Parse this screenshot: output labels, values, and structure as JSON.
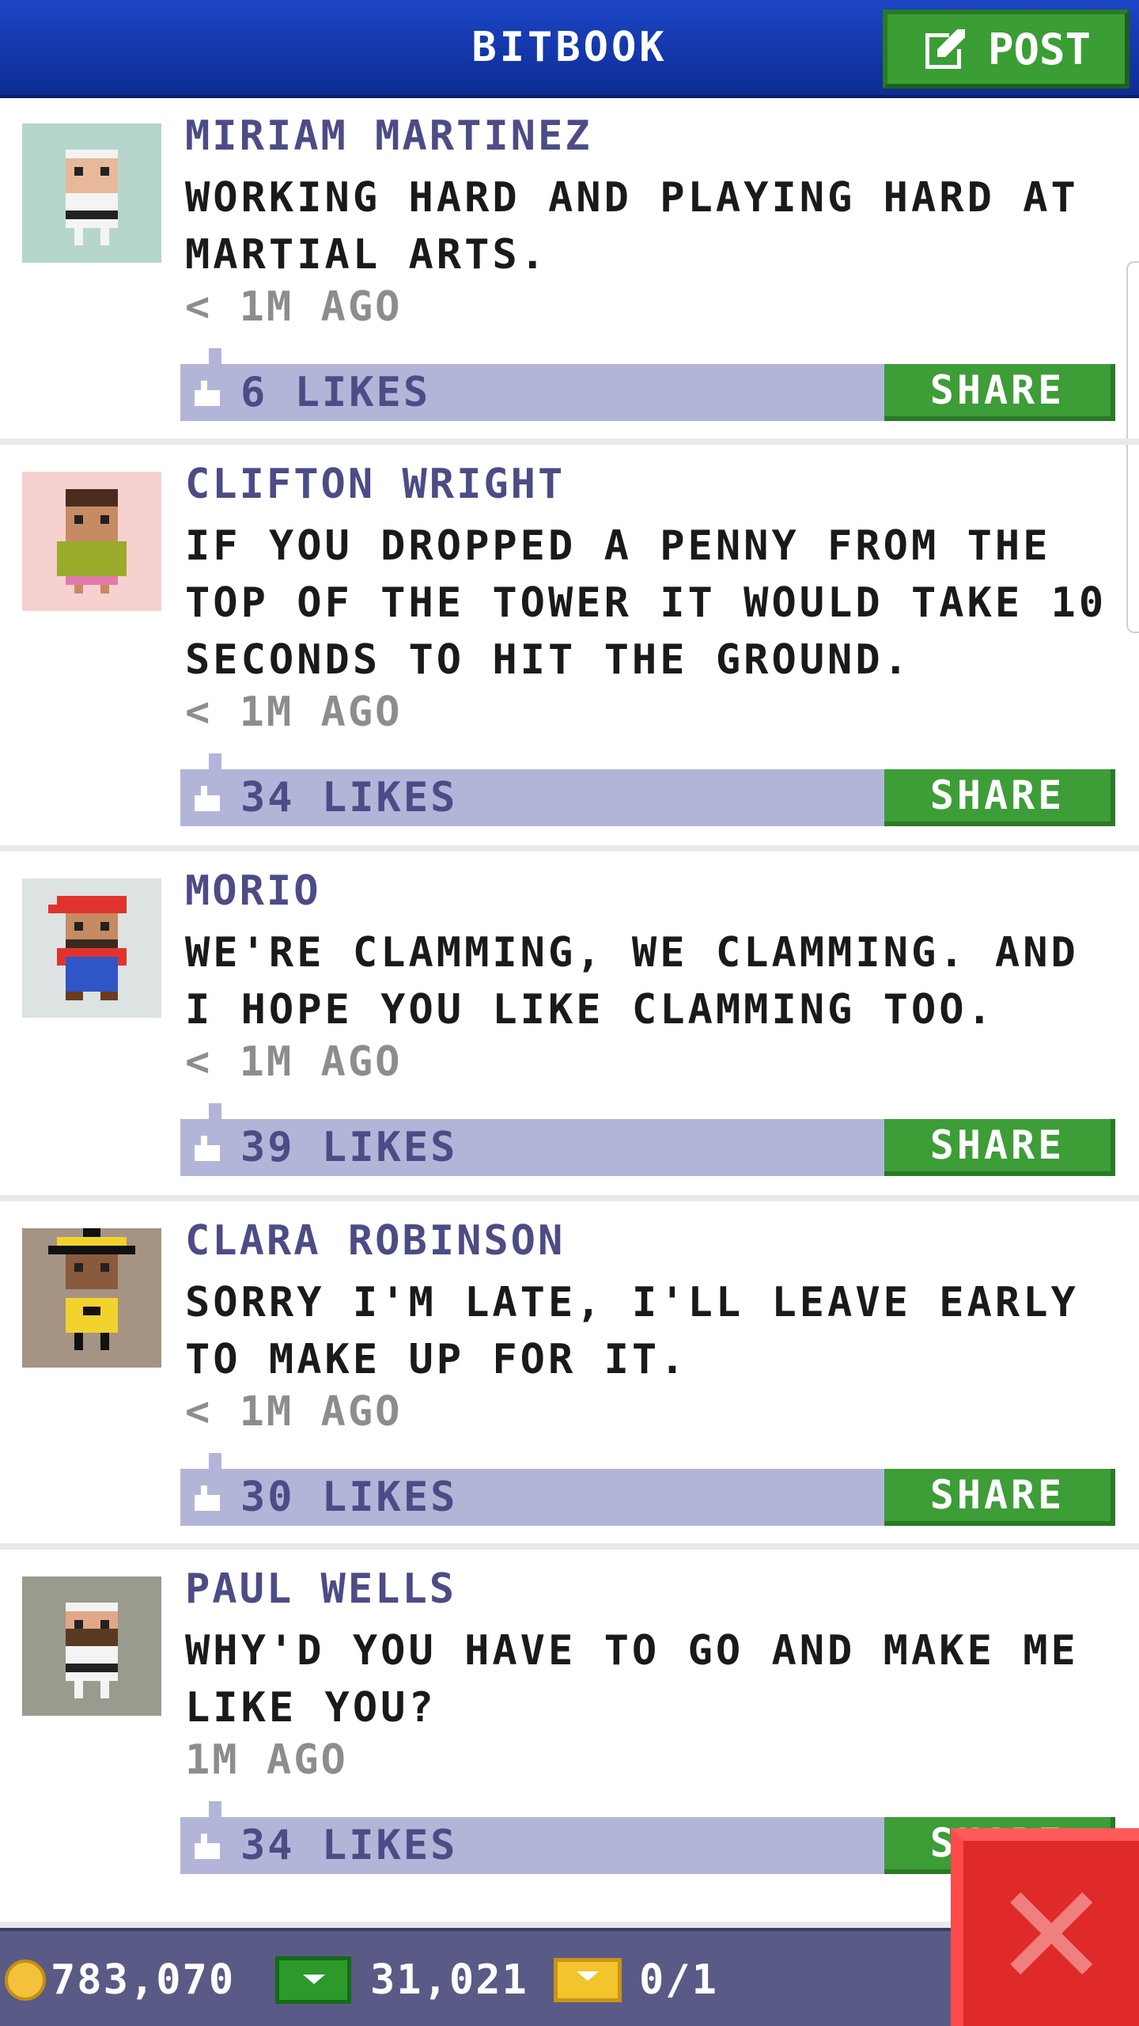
{
  "header": {
    "title": "BITBOOK",
    "post_label": "POST"
  },
  "feed": {
    "posts": [
      {
        "name": "MIRIAM MARTINEZ",
        "message": "WORKING HARD AND PLAYING HARD AT MARTIAL ARTS.",
        "time": "< 1M AGO",
        "likes": "6 LIKES",
        "share": "SHARE"
      },
      {
        "name": "CLIFTON WRIGHT",
        "message": "IF YOU DROPPED A PENNY FROM THE TOP OF THE TOWER IT WOULD TAKE 10 SECONDS TO HIT THE GROUND.",
        "time": "< 1M AGO",
        "likes": "34 LIKES",
        "share": "SHARE"
      },
      {
        "name": "MORIO",
        "message": "WE'RE CLAMMING, WE CLAMMING. AND I HOPE YOU LIKE CLAMMING TOO.",
        "time": "< 1M AGO",
        "likes": "39 LIKES",
        "share": "SHARE"
      },
      {
        "name": "CLARA ROBINSON",
        "message": "SORRY I'M LATE, I'LL LEAVE EARLY TO MAKE UP FOR IT.",
        "time": "< 1M AGO",
        "likes": "30 LIKES",
        "share": "SHARE"
      },
      {
        "name": "PAUL WELLS",
        "message": "WHY'D YOU HAVE TO GO AND MAKE ME LIKE YOU?",
        "time": "1M AGO",
        "likes": "34 LIKES",
        "share": "SHARE"
      }
    ]
  },
  "footer": {
    "coins": "783,070",
    "bux": "31,021",
    "tickets": "0/1"
  },
  "icons": {
    "post": "edit-icon",
    "like": "thumbs-up-icon",
    "coin": "coin-icon",
    "bux": "bux-icon",
    "ticket": "ticket-icon",
    "close": "close-icon"
  },
  "colors": {
    "header": "#1c45c7",
    "accent_green": "#3d9d37",
    "likes_bar": "#b3b5d8",
    "name": "#4c4c86",
    "close": "#e02a2a",
    "footer": "#5a5a86"
  }
}
